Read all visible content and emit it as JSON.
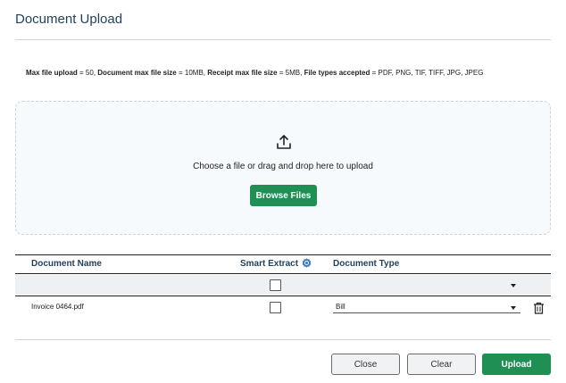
{
  "dialog": {
    "title": "Document Upload"
  },
  "limits": {
    "max_upload_label": "Max file upload",
    "max_upload_value": "= 50,",
    "doc_size_label": "Document max file size",
    "doc_size_value": "= 10MB,",
    "receipt_size_label": "Receipt max file size",
    "receipt_size_value": "= 5MB,",
    "types_label": "File types accepted",
    "types_value": "= PDF, PNG, TIF, TIFF, JPG, JPEG"
  },
  "dropzone": {
    "icon": "upload-icon",
    "text": "Choose a file or drag and drop here to upload",
    "browse_label": "Browse Files"
  },
  "table": {
    "headers": {
      "document_name": "Document Name",
      "smart_extract": "Smart Extract",
      "smart_extract_icon": "info-badge-icon",
      "document_type": "Document Type"
    },
    "rows": [
      {
        "document_name": "Invoice 0464.pdf",
        "smart_extract": false,
        "document_type": "Bill"
      }
    ]
  },
  "footer": {
    "close_label": "Close",
    "clear_label": "Clear",
    "upload_label": "Upload"
  },
  "colors": {
    "primary_green": "#1f8f53",
    "title_blue": "#1f3f5a",
    "dropzone_bg": "#f7fafd",
    "info_badge": "#3a78c9"
  }
}
